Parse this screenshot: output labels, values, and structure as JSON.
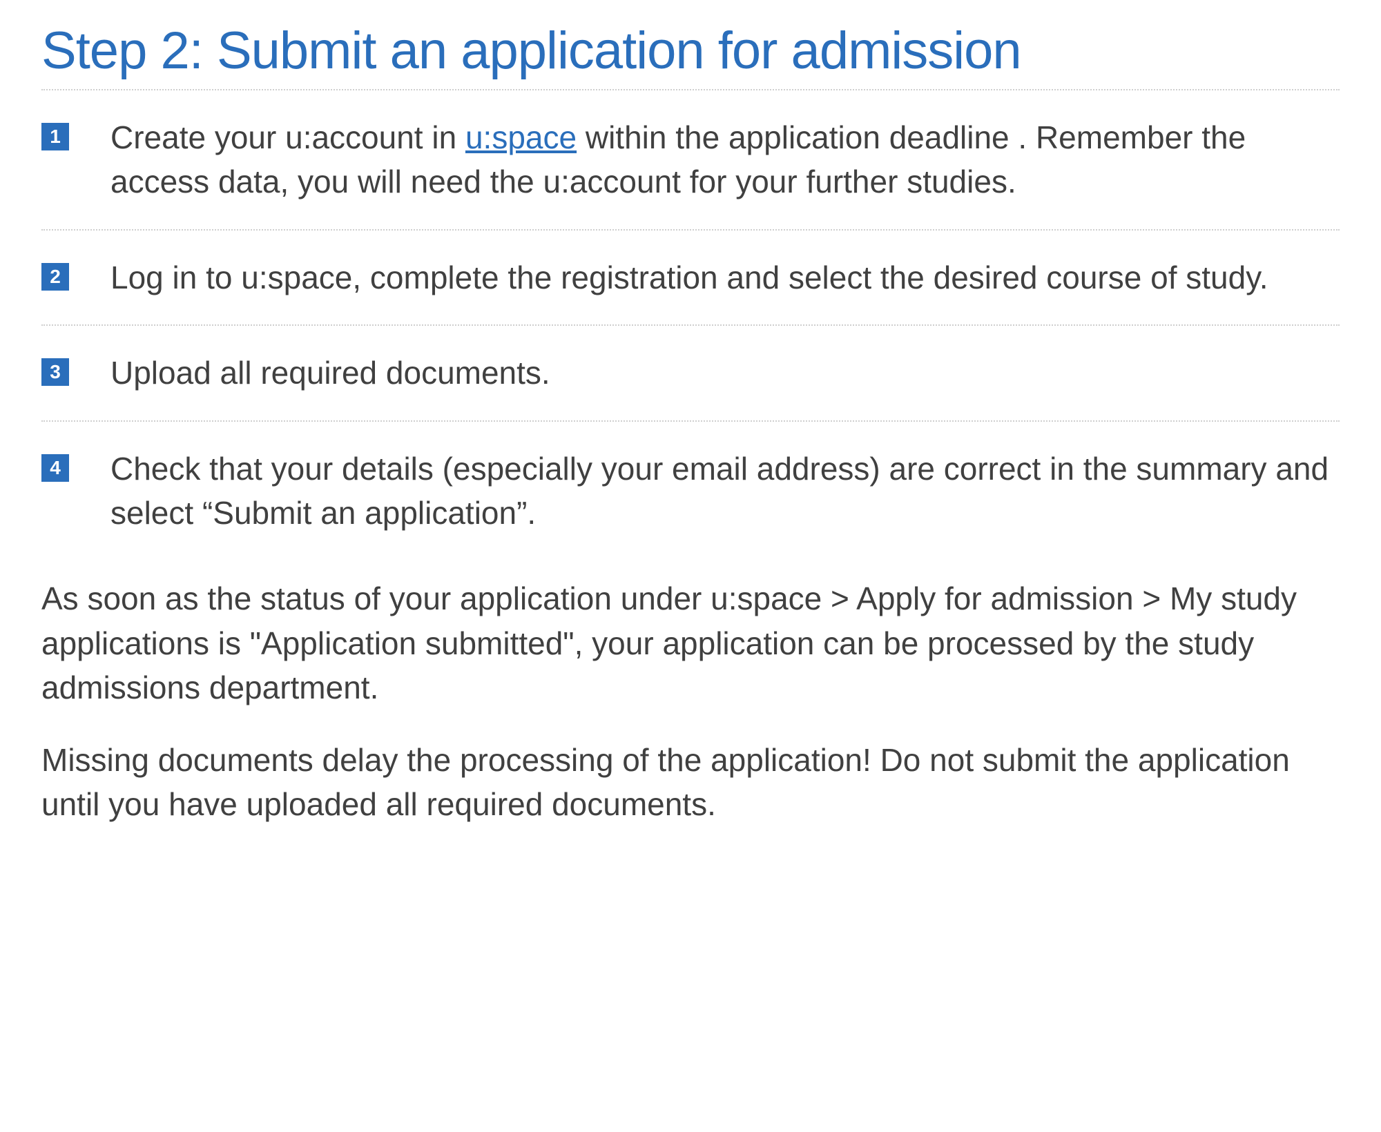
{
  "title": "Step 2: Submit an application for admission",
  "list": {
    "item1_before": "Create your u:account in  ",
    "item1_link": "u:space",
    "item1_after": " within the application deadline  . Remember the access data, you will need the u:account for your further studies.",
    "item2": "Log in to u:space, complete the registration and select the desired course of study.",
    "item3": "Upload all required documents.",
    "item4": "Check that your details (especially your email address) are correct in the summary and select “Submit an application”."
  },
  "paragraph1": "As soon as the status of your application under u:space > Apply for admission > My study applications is \"Application submitted\", your application can be processed by the study admissions department.",
  "paragraph2": "Missing documents delay the processing of the application! Do not submit the application until you have uploaded all required documents."
}
